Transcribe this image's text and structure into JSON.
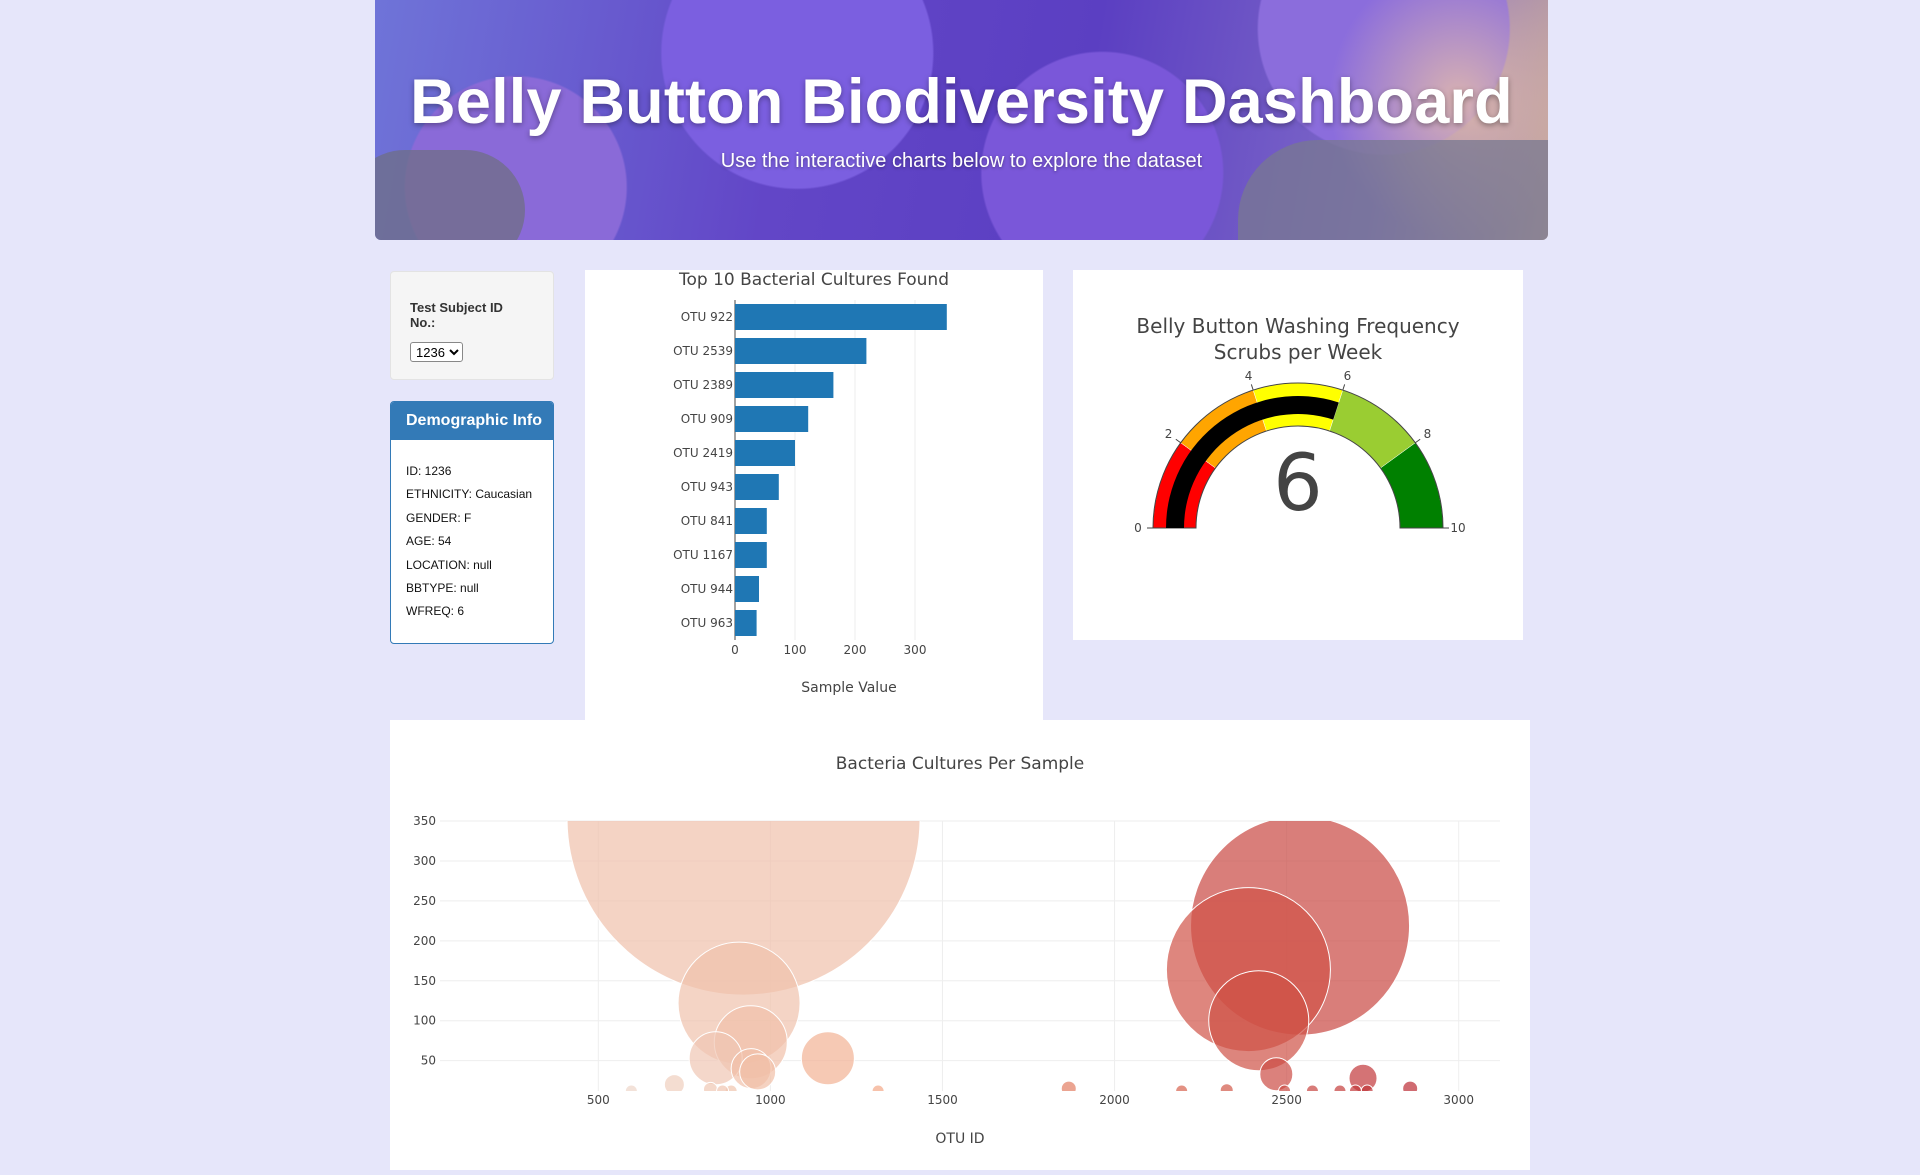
{
  "header": {
    "title": "Belly Button Biodiversity Dashboard",
    "subtitle": "Use the interactive charts below to explore the dataset"
  },
  "selector": {
    "label": "Test Subject ID No.:",
    "selected": "1236"
  },
  "demographics": {
    "title": "Demographic Info",
    "lines": [
      "ID: 1236",
      "ETHNICITY: Caucasian",
      "GENDER: F",
      "AGE: 54",
      "LOCATION: null",
      "BBTYPE: null",
      "WFREQ: 6"
    ]
  },
  "colors": {
    "page_bg": "#e6e6fa",
    "panel_primary": "#337ab7",
    "bar": "#1f77b4"
  },
  "chart_data": [
    {
      "type": "bar",
      "orientation": "horizontal",
      "title": "Top 10 Bacterial Cultures Found",
      "xlabel": "Sample Value",
      "ylabel": "",
      "xticks": [
        0,
        100,
        200,
        300
      ],
      "xlim": [
        0,
        360
      ],
      "categories": [
        "OTU 922",
        "OTU 2539",
        "OTU 2389",
        "OTU 909",
        "OTU 2419",
        "OTU 943",
        "OTU 841",
        "OTU 1167",
        "OTU 944",
        "OTU 963"
      ],
      "values": [
        353,
        219,
        164,
        122,
        100,
        73,
        53,
        53,
        40,
        36
      ]
    },
    {
      "type": "gauge",
      "title_line1": "Belly Button Washing Frequency",
      "title_line2": "Scrubs per Week",
      "value": 6,
      "range": [
        0,
        10
      ],
      "ticks": [
        0,
        2,
        4,
        6,
        8,
        10
      ],
      "steps": [
        {
          "range": [
            0,
            2
          ],
          "color": "#ff0000"
        },
        {
          "range": [
            2,
            4
          ],
          "color": "#ffa500"
        },
        {
          "range": [
            4,
            6
          ],
          "color": "#ffff00"
        },
        {
          "range": [
            6,
            8
          ],
          "color": "#9acd32"
        },
        {
          "range": [
            8,
            10
          ],
          "color": "#008000"
        }
      ],
      "bar_color": "#000000"
    },
    {
      "type": "scatter",
      "subtype": "bubble",
      "title": "Bacteria Cultures Per Sample",
      "xlabel": "OTU ID",
      "ylabel": "",
      "xticks": [
        500,
        1000,
        1500,
        2000,
        2500,
        3000
      ],
      "yticks": [
        50,
        100,
        150,
        200,
        250,
        300,
        350
      ],
      "xlim": [
        40,
        3120
      ],
      "ylim": [
        12,
        350
      ],
      "grid": true,
      "points": [
        {
          "x": 922,
          "y": 353
        },
        {
          "x": 2539,
          "y": 219
        },
        {
          "x": 2389,
          "y": 164
        },
        {
          "x": 909,
          "y": 122
        },
        {
          "x": 2419,
          "y": 100
        },
        {
          "x": 943,
          "y": 73
        },
        {
          "x": 841,
          "y": 53
        },
        {
          "x": 1167,
          "y": 53
        },
        {
          "x": 944,
          "y": 40
        },
        {
          "x": 963,
          "y": 36
        },
        {
          "x": 2470,
          "y": 33
        },
        {
          "x": 2722,
          "y": 28
        },
        {
          "x": 721,
          "y": 20
        },
        {
          "x": 1867,
          "y": 15
        },
        {
          "x": 2859,
          "y": 15
        },
        {
          "x": 826,
          "y": 14
        },
        {
          "x": 2326,
          "y": 13
        },
        {
          "x": 2575,
          "y": 12
        },
        {
          "x": 2494,
          "y": 12
        },
        {
          "x": 596,
          "y": 12
        },
        {
          "x": 1313,
          "y": 12
        },
        {
          "x": 2655,
          "y": 12
        },
        {
          "x": 2734,
          "y": 12
        },
        {
          "x": 886,
          "y": 12
        },
        {
          "x": 861,
          "y": 12
        },
        {
          "x": 2195,
          "y": 12
        },
        {
          "x": 2700,
          "y": 12
        }
      ]
    }
  ]
}
